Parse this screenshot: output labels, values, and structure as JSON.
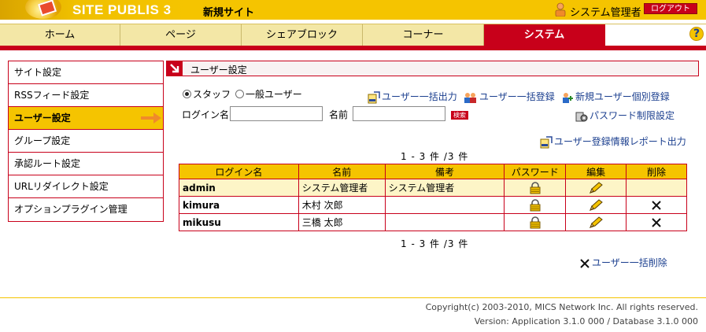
{
  "header": {
    "logo_text": "SITE PUBLIS 3",
    "site_name": "新規サイト",
    "admin_name": "システム管理者",
    "logout_label": "ログアウト"
  },
  "nav": {
    "tabs": [
      {
        "label": "ホーム"
      },
      {
        "label": "ページ"
      },
      {
        "label": "シェアブロック"
      },
      {
        "label": "コーナー"
      },
      {
        "label": "システム"
      }
    ],
    "help_label": "?"
  },
  "sidebar": {
    "items": [
      {
        "label": "サイト設定"
      },
      {
        "label": "RSSフィード設定"
      },
      {
        "label": "ユーザー設定"
      },
      {
        "label": "グループ設定"
      },
      {
        "label": "承認ルート設定"
      },
      {
        "label": "URLリダイレクト設定"
      },
      {
        "label": "オプションプラグイン管理"
      }
    ]
  },
  "main": {
    "section_title": "ユーザー設定",
    "radio_staff": "スタッフ",
    "radio_general": "一般ユーザー",
    "links": {
      "bulk_export": "ユーザー一括出力",
      "bulk_register": "ユーザー一括登録",
      "new_user": "新規ユーザー個別登録",
      "password_limit": "パスワード制限設定",
      "report_export": "ユーザー登録情報レポート出力",
      "bulk_delete": "ユーザー一括削除"
    },
    "login_label": "ログイン名",
    "login_value": "",
    "name_label": "名前",
    "name_value": "",
    "search_label": "検索",
    "count_text": "1 - 3 件 /3 件"
  },
  "table": {
    "headers": [
      "ログイン名",
      "名前",
      "備考",
      "パスワード",
      "編集",
      "削除"
    ],
    "rows": [
      {
        "login": "admin",
        "name": "システム管理者",
        "note": "システム管理者",
        "deletable": false
      },
      {
        "login": "kimura",
        "name": "木村 次郎",
        "note": "",
        "deletable": true
      },
      {
        "login": "mikusu",
        "name": "三橋 太郎",
        "note": "",
        "deletable": true
      }
    ]
  },
  "footer": {
    "copyright": "Copyright(c) 2003-2010, MICS Network Inc. All rights reserved.",
    "version": "Version: Application 3.1.0 000  / Database 3.1.0 000"
  },
  "colors": {
    "brand_yellow": "#f5c400",
    "brand_red": "#c8001a",
    "link_blue": "#1b3f8f"
  }
}
